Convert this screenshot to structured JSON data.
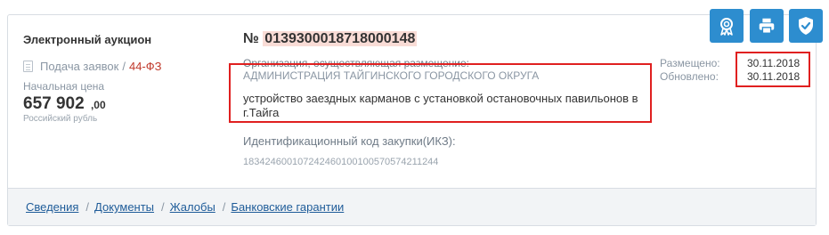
{
  "procurement": {
    "type": "Электронный аукцион",
    "stage": "Подача заявок",
    "stage_separator": "/",
    "law": "44-ФЗ",
    "price_label": "Начальная цена",
    "price_main": "657 902",
    "price_kop": ",00",
    "currency": "Российский рубль"
  },
  "notice": {
    "number_prefix": "№",
    "number": "0139300018718000148",
    "org_label": "Организация, осуществляющая размещение:",
    "org_name": "АДМИНИСТРАЦИЯ ТАЙГИНСКОГО ГОРОДСКОГО ОКРУГА",
    "subject": "устройство заездных карманов с установкой остановочных павильонов в г.Тайга",
    "ikz_label": "Идентификационный код закупки(ИКЗ):",
    "ikz": "183424600107242460100100570574211244"
  },
  "dates": {
    "posted_label": "Размещено:",
    "updated_label": "Обновлено:",
    "posted": "30.11.2018",
    "updated": "30.11.2018"
  },
  "actions": {
    "icons": [
      "award-icon",
      "print-icon",
      "shield-check-icon"
    ],
    "color": "#2d8dcf"
  },
  "footer": {
    "links": [
      "Сведения",
      "Документы",
      "Жалобы",
      "Банковские гарантии"
    ],
    "separator": "/"
  },
  "colors": {
    "highlight": "#e02020",
    "number_bg": "#f9dcd6",
    "link": "#1f5c99"
  }
}
